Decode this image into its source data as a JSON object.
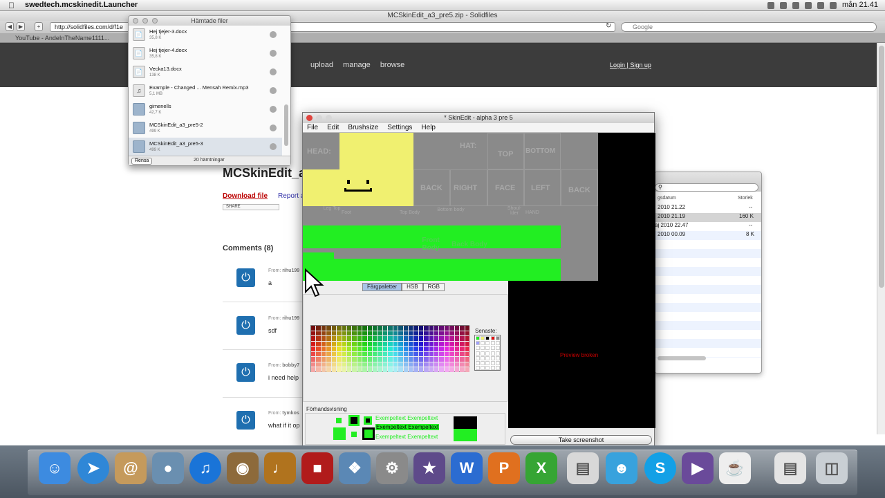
{
  "menubar": {
    "app": "swedtech.mcskinedit.Launcher",
    "clock": "mån 21.41"
  },
  "browser": {
    "title": "MCSkinEdit_a3_pre5.zip - Solidfiles",
    "url": "http://solidfiles.com/d/f1e",
    "search_placeholder": "Google",
    "tab": "YouTube - AndeInTheName1111...",
    "nav": [
      "upload",
      "manage",
      "browse"
    ],
    "login": "Login",
    "signup": "Sign up",
    "page_title": "MCSkinEdit_a3",
    "download_link": "Download file",
    "report_link": "Report a",
    "share_label": "SHARE",
    "comments_heading": "Comments (8)",
    "comments": [
      {
        "from": "From:",
        "user": "rihu199",
        "text": "a"
      },
      {
        "from": "From:",
        "user": "rihu199",
        "text": "sdf"
      },
      {
        "from": "From:",
        "user": "bobby7",
        "text": "i need help"
      },
      {
        "from": "From:",
        "user": "tymkos",
        "text": "what if it op"
      }
    ]
  },
  "downloads": {
    "title": "Hämtade filer",
    "items": [
      {
        "name": "Hej tjejer-3.docx",
        "size": "35,8 K",
        "type": "doc"
      },
      {
        "name": "Hej tjejer-4.docx",
        "size": "35,8 K",
        "type": "doc"
      },
      {
        "name": "Vecka13.docx",
        "size": "138 K",
        "type": "doc"
      },
      {
        "name": "Example - Changed ... Mensah Remix.mp3",
        "size": "5,1 MB",
        "type": "audio"
      },
      {
        "name": "gimenells",
        "size": "42,7 K",
        "type": "folder"
      },
      {
        "name": "MCSkinEdit_a3_pre5-2",
        "size": "499 K",
        "type": "folder"
      },
      {
        "name": "MCSkinEdit_a3_pre5-3",
        "size": "499 K",
        "type": "folder"
      }
    ],
    "clear_button": "Rensa",
    "count": "20 hämtningar"
  },
  "finder": {
    "col_date": "gsdatum",
    "col_size": "Storlek",
    "rows": [
      {
        "date": "2010 21.22",
        "size": "--"
      },
      {
        "date": "2010 21.19",
        "size": "160 K"
      },
      {
        "date": "aj 2010 22.47",
        "size": "--"
      },
      {
        "date": "2010 00.09",
        "size": "8 K"
      }
    ]
  },
  "skinedit": {
    "title": "* SkinEdit - alpha 3 pre 5",
    "menu": [
      "File",
      "Edit",
      "Brushsize",
      "Settings",
      "Help"
    ],
    "labels": {
      "head": "HEAD:",
      "hat": "HAT:",
      "top": "TOP",
      "bottom": "BOTTOM",
      "back": "BACK",
      "right": "RIGHT",
      "face": "FACE",
      "left": "LEFT",
      "back2": "BACK",
      "legtop": "Leg Top",
      "foot": "Foot",
      "topbody": "Top Body",
      "bottombody": "Bottom body",
      "shoulder": "Shoul- lder",
      "hand": "HAND",
      "front_body": "Front Body",
      "back_body": "Back Body"
    },
    "color_tabs": [
      "Färgpaletter",
      "HSB",
      "RGB"
    ],
    "recent_label": "Senaste:",
    "preview_label": "Förhandsvisning",
    "example_text": "Exempeltext Exempeltext",
    "preview_broken": "Preview broken",
    "screenshot_button": "Take screenshot"
  },
  "dock": [
    "finder-icon",
    "safari-icon",
    "contacts-icon",
    "iphoto-icon",
    "itunes-icon",
    "image-capture-icon",
    "garageband-icon",
    "photo-booth-icon",
    "preview-icon",
    "system-preferences-icon",
    "imovie-icon",
    "word-icon",
    "powerpoint-icon",
    "excel-icon",
    "stack-icon",
    "messenger-icon",
    "skype-icon",
    "dvd-player-icon",
    "coffee-icon",
    "downloads-stack-icon",
    "trash-icon"
  ]
}
